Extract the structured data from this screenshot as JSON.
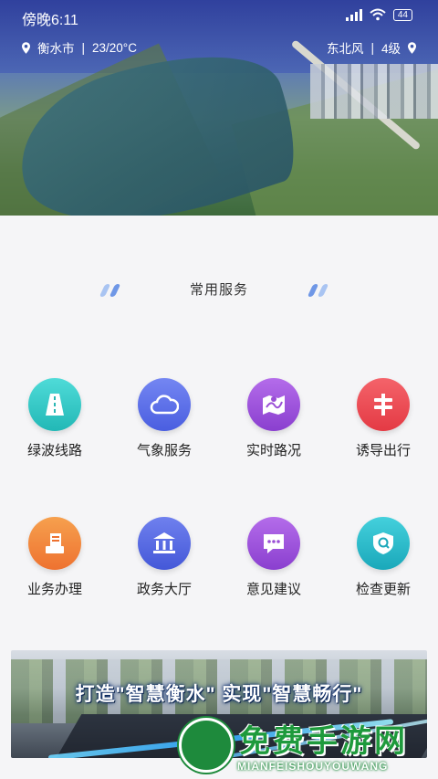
{
  "statusbar": {
    "time": "傍晚6:11",
    "battery": "44"
  },
  "weather": {
    "city": "衡水市",
    "temperature": "23/20°C",
    "wind_direction": "东北风",
    "wind_level": "4级",
    "separator": "|"
  },
  "section": {
    "title": "常用服务"
  },
  "services_row1": [
    {
      "label": "绿波线路",
      "icon": "road-icon",
      "color": "#2ec8c6"
    },
    {
      "label": "气象服务",
      "icon": "cloud-icon",
      "color": "#5b6fe6"
    },
    {
      "label": "实时路况",
      "icon": "map-icon",
      "color": "#9a4fd6"
    },
    {
      "label": "诱导出行",
      "icon": "signpost-icon",
      "color": "#ee4a52"
    }
  ],
  "services_row2": [
    {
      "label": "业务办理",
      "icon": "document-stack-icon",
      "color": "#f2873a"
    },
    {
      "label": "政务大厅",
      "icon": "government-building-icon",
      "color": "#5568e0"
    },
    {
      "label": "意见建议",
      "icon": "chat-bubble-icon",
      "color": "#9a4fd6"
    },
    {
      "label": "检查更新",
      "icon": "update-check-icon",
      "color": "#23b8c8"
    }
  ],
  "banner": {
    "slogan": "打造\"智慧衡水\" 实现\"智慧畅行\""
  },
  "watermark": {
    "title": "免费手游网",
    "subtitle": "MIANFEISHOUYOUWANG"
  }
}
